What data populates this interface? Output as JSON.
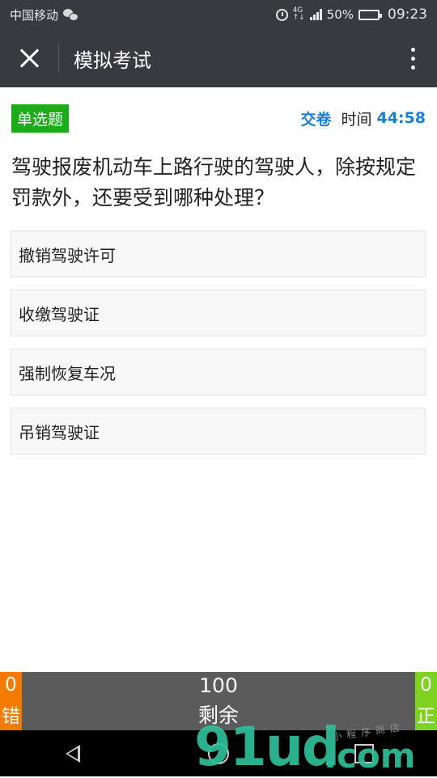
{
  "status_bar": {
    "carrier": "中国移动",
    "network_top": "4G",
    "network_bottom": "↑↓",
    "battery_percent": "50%",
    "battery_level": 0.5,
    "time": "09:23",
    "icons": [
      "wechat-icon",
      "alarm-icon",
      "signal-icon",
      "battery-icon"
    ]
  },
  "title_bar": {
    "title": "模拟考试",
    "close_icon": "close-icon",
    "more_icon": "more-vertical-icon"
  },
  "exam": {
    "question_type": "单选题",
    "submit_label": "交卷",
    "timer_label": "时间",
    "timer_value": "44:58"
  },
  "question": {
    "text": "驾驶报废机动车上路行驶的驾驶人，除按规定罚款外，还要受到哪种处理？",
    "options": [
      "撤销驾驶许可",
      "收缴驾驶证",
      "强制恢复车况",
      "吊销驾驶证"
    ]
  },
  "stats": {
    "wrong_count": "0",
    "wrong_label": "错",
    "remaining_count": "100",
    "remaining_label": "剩余",
    "correct_count": "0",
    "correct_label": "正"
  },
  "nav_bar": {
    "icons": [
      "back-icon",
      "home-icon",
      "recent-apps-icon"
    ]
  },
  "watermark": {
    "main": "91ud",
    "domain": ".com",
    "sub": "小程序商店"
  },
  "colors": {
    "bar_dark": "#393a3f",
    "badge_green": "#1aad19",
    "accent_blue": "#1a7fd4",
    "wrong_orange": "#f57b00",
    "correct_green": "#7ed321",
    "stats_gray": "#5b5b5b"
  }
}
